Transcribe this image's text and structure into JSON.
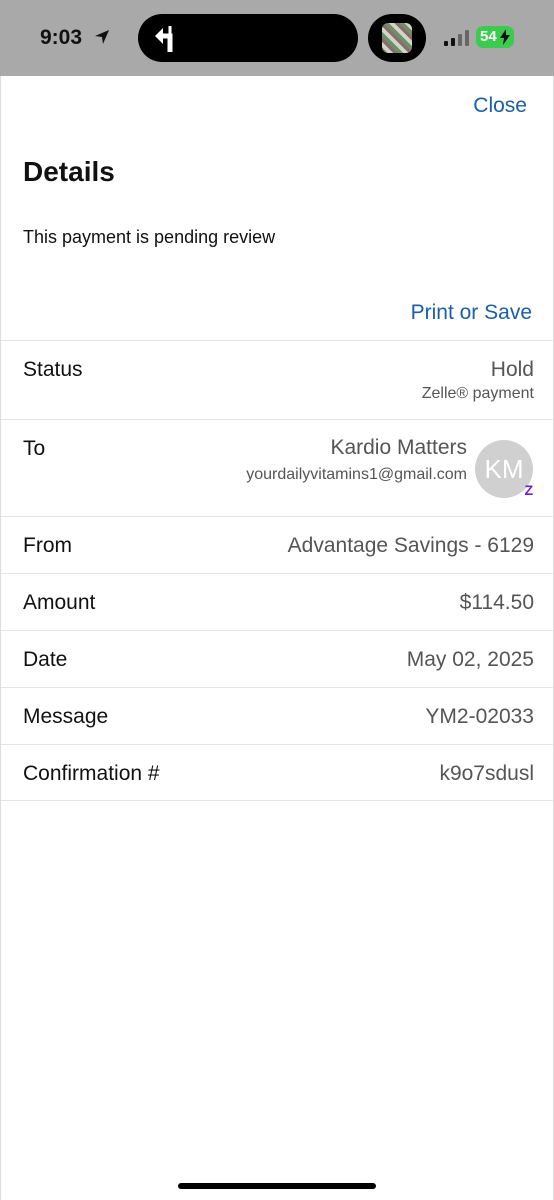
{
  "status_bar": {
    "time": "9:03",
    "battery": "54",
    "icons": [
      "location-arrow-icon",
      "turn-left-icon",
      "signal-icon",
      "charging-bolt-icon"
    ]
  },
  "header": {
    "close_label": "Close",
    "title": "Details",
    "subtitle": "This payment is pending review",
    "print_label": "Print or Save"
  },
  "details": {
    "status": {
      "label": "Status",
      "value": "Hold",
      "sub": "Zelle® payment"
    },
    "to": {
      "label": "To",
      "name": "Kardio Matters",
      "email": "yourdailyvitamins1@gmail.com",
      "avatar_initials": "KM"
    },
    "from": {
      "label": "From",
      "value": "Advantage Savings - 6129"
    },
    "amount": {
      "label": "Amount",
      "value": "$114.50"
    },
    "date": {
      "label": "Date",
      "value": "May 02, 2025"
    },
    "message": {
      "label": "Message",
      "value": "YM2-02033"
    },
    "confirmation": {
      "label": "Confirmation #",
      "value": "k9o7sdusl"
    }
  },
  "colors": {
    "link": "#1a5fa8",
    "battery": "#3ccb4e",
    "zelle": "#6d1ed4"
  }
}
